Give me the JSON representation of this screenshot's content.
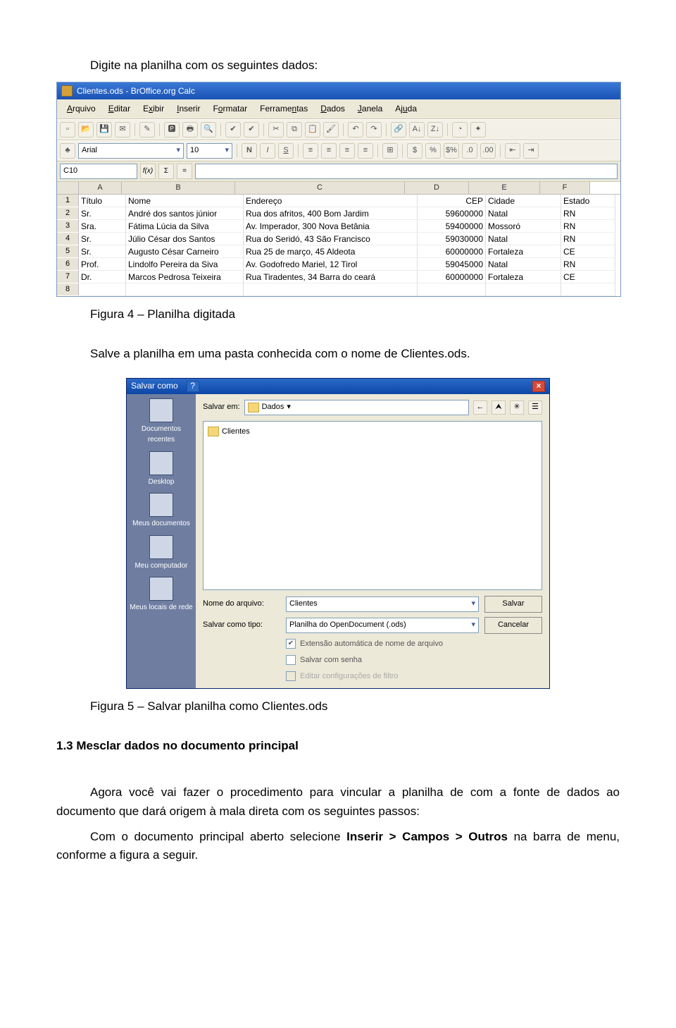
{
  "intro": "Digite na planilha com os seguintes dados:",
  "fig4": "Figura 4 – Planilha digitada",
  "line_save": "Salve a planilha em uma pasta conhecida com o nome de Clientes.ods.",
  "fig5": "Figura 5 – Salvar planilha como Clientes.ods",
  "heading": "1.3 Mesclar dados no documento principal",
  "p1": "Agora você vai fazer o procedimento para vincular a planilha de com a fonte de dados ao documento que dará origem à mala direta com os seguintes passos:",
  "p2a": "Com o documento principal aberto selecione ",
  "p2b": "Inserir > Campos > Outros",
  "p2c": " na barra de menu, conforme a figura a seguir.",
  "calc": {
    "title": "Clientes.ods - BrOffice.org Calc",
    "menus": [
      "Arquivo",
      "Editar",
      "Exibir",
      "Inserir",
      "Formatar",
      "Ferramentas",
      "Dados",
      "Janela",
      "Ajuda"
    ],
    "font": "Arial",
    "size": "10",
    "cellref": "C10",
    "cols": [
      "A",
      "B",
      "C",
      "D",
      "E",
      "F"
    ],
    "rows": [
      {
        "r": "1",
        "A": "Título",
        "B": "Nome",
        "C": "Endereço",
        "D": "CEP",
        "E": "Cidade",
        "F": "Estado"
      },
      {
        "r": "2",
        "A": "Sr.",
        "B": "André dos santos júnior",
        "C": "Rua dos afritos, 400 Bom Jardim",
        "D": "59600000",
        "E": "Natal",
        "F": "RN"
      },
      {
        "r": "3",
        "A": "Sra.",
        "B": "Fátima Lúcia da Silva",
        "C": "Av. Imperador, 300 Nova Betânia",
        "D": "59400000",
        "E": "Mossoró",
        "F": "RN"
      },
      {
        "r": "4",
        "A": "Sr.",
        "B": "Júlio César dos Santos",
        "C": "Rua do Seridó, 43 São Francisco",
        "D": "59030000",
        "E": "Natal",
        "F": "RN"
      },
      {
        "r": "5",
        "A": "Sr.",
        "B": "Augusto César Carneiro",
        "C": "Rua 25 de março, 45 Aldeota",
        "D": "60000000",
        "E": "Fortaleza",
        "F": "CE"
      },
      {
        "r": "6",
        "A": "Prof.",
        "B": "Lindolfo Pereira da Siva",
        "C": "Av. Godofredo Mariel, 12 Tirol",
        "D": "59045000",
        "E": "Natal",
        "F": "RN"
      },
      {
        "r": "7",
        "A": "Dr.",
        "B": "Marcos Pedrosa Teixeira",
        "C": "Rua Tiradentes, 34 Barra do ceará",
        "D": "60000000",
        "E": "Fortaleza",
        "F": "CE"
      }
    ]
  },
  "dlg": {
    "title": "Salvar como",
    "places": [
      "Documentos recentes",
      "Desktop",
      "Meus documentos",
      "Meu computador",
      "Meus locais de rede"
    ],
    "savein_label": "Salvar em:",
    "savein_value": "Dados",
    "file": "Clientes",
    "name_label": "Nome do arquivo:",
    "name_value": "Clientes",
    "type_label": "Salvar como tipo:",
    "type_value": "Planilha do OpenDocument (.ods)",
    "btn_save": "Salvar",
    "btn_cancel": "Cancelar",
    "chk1": "Extensão automática de nome de arquivo",
    "chk2": "Salvar com senha",
    "chk3": "Editar configurações de filtro"
  }
}
